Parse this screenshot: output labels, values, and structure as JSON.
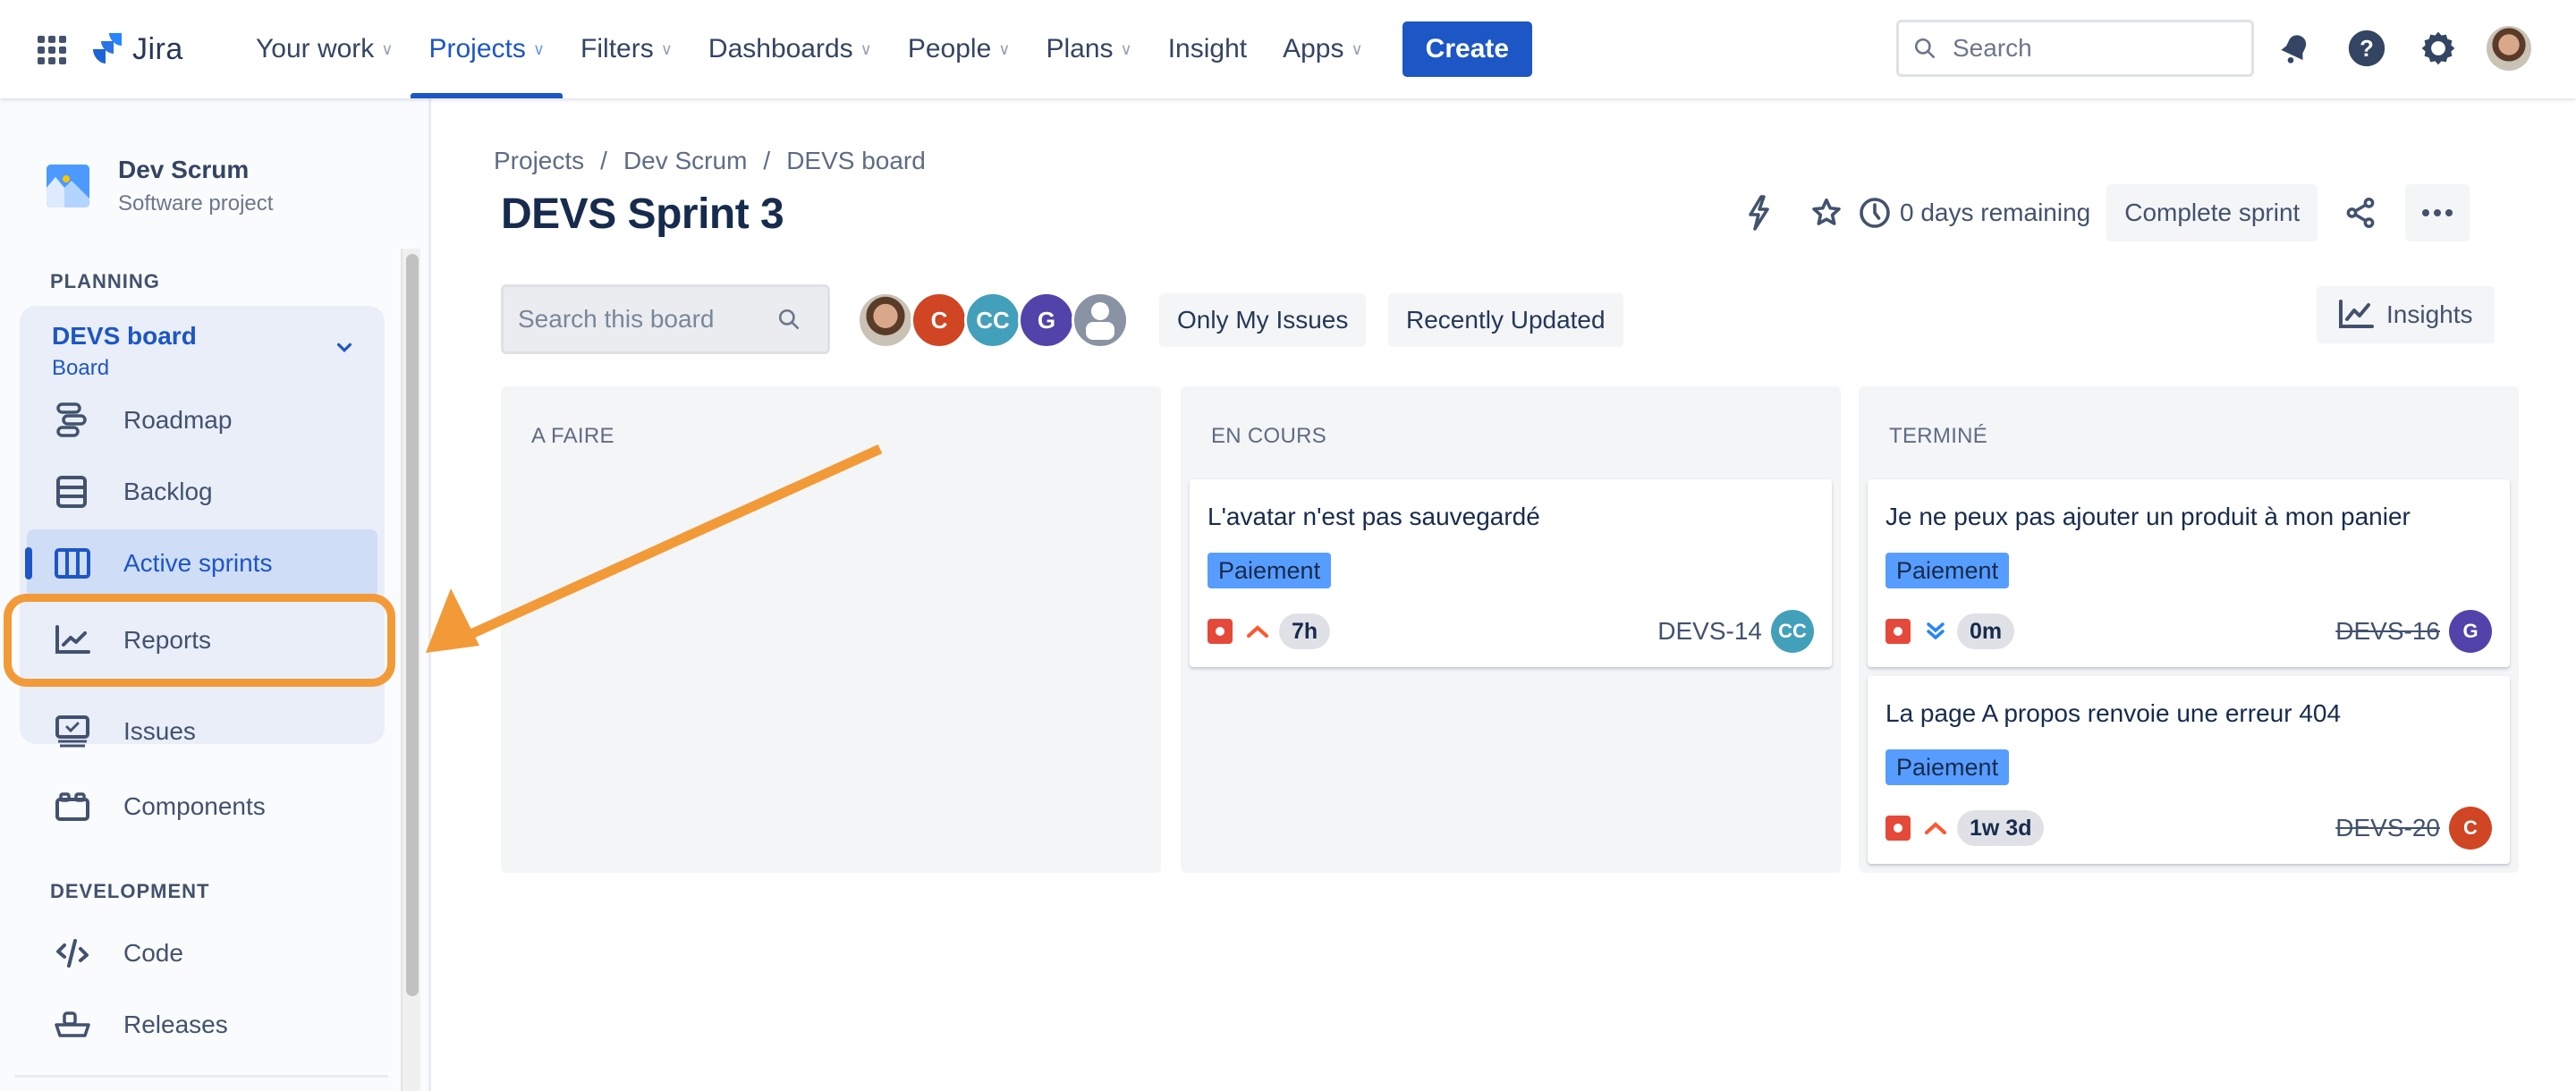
{
  "topnav": {
    "app_name": "Jira",
    "items": [
      {
        "label": "Your work",
        "has_dropdown": true
      },
      {
        "label": "Projects",
        "has_dropdown": true,
        "active": true
      },
      {
        "label": "Filters",
        "has_dropdown": true
      },
      {
        "label": "Dashboards",
        "has_dropdown": true
      },
      {
        "label": "People",
        "has_dropdown": true
      },
      {
        "label": "Plans",
        "has_dropdown": true
      },
      {
        "label": "Insight",
        "has_dropdown": false
      },
      {
        "label": "Apps",
        "has_dropdown": true
      }
    ],
    "create_label": "Create",
    "search_placeholder": "Search",
    "icons": [
      "app-switcher-icon",
      "notifications-icon",
      "help-icon",
      "settings-icon",
      "profile-avatar"
    ]
  },
  "sidebar": {
    "project_name": "Dev Scrum",
    "project_type": "Software project",
    "planning_label": "PLANNING",
    "board_name": "DEVS board",
    "board_type": "Board",
    "planning_items": [
      {
        "label": "Roadmap",
        "icon": "roadmap-icon"
      },
      {
        "label": "Backlog",
        "icon": "backlog-icon"
      },
      {
        "label": "Active sprints",
        "icon": "board-columns-icon",
        "active": true
      },
      {
        "label": "Reports",
        "icon": "reports-chart-icon",
        "highlighted": true
      }
    ],
    "other_items": [
      {
        "label": "Issues",
        "icon": "issues-icon"
      },
      {
        "label": "Components",
        "icon": "components-icon"
      }
    ],
    "development_label": "DEVELOPMENT",
    "development_items": [
      {
        "label": "Code",
        "icon": "code-icon"
      },
      {
        "label": "Releases",
        "icon": "releases-ship-icon"
      }
    ]
  },
  "breadcrumb": [
    "Projects",
    "Dev Scrum",
    "DEVS board"
  ],
  "page_title": "DEVS Sprint 3",
  "header_actions": {
    "days_remaining": "0 days remaining",
    "complete_sprint_label": "Complete sprint"
  },
  "toolbar": {
    "search_placeholder": "Search this board",
    "avatars": [
      {
        "initials": "",
        "type": "photo"
      },
      {
        "initials": "C",
        "color": "#d04523"
      },
      {
        "initials": "CC",
        "color": "#43a0bb"
      },
      {
        "initials": "G",
        "color": "#5243aa"
      },
      {
        "initials": "",
        "type": "unassigned",
        "color": "#8993a4"
      }
    ],
    "filters": [
      "Only My Issues",
      "Recently Updated"
    ],
    "insights_label": "Insights"
  },
  "columns": [
    {
      "title": "A FAIRE",
      "cards": []
    },
    {
      "title": "EN COURS",
      "cards": [
        {
          "title": "L'avatar n'est pas sauvegardé",
          "label": "Paiement",
          "type": "bug",
          "priority": "high",
          "estimate": "7h",
          "key": "DEVS-14",
          "done": false,
          "assignee": "CC",
          "assignee_color": "#43a0bb"
        }
      ]
    },
    {
      "title": "TERMINÉ",
      "cards": [
        {
          "title": "Je ne peux pas ajouter un produit à mon panier",
          "label": "Paiement",
          "type": "bug",
          "priority": "lowest",
          "estimate": "0m",
          "key": "DEVS-16",
          "done": true,
          "assignee": "G",
          "assignee_color": "#5243aa"
        },
        {
          "title": "La page A propos renvoie une erreur 404",
          "label": "Paiement",
          "type": "bug",
          "priority": "high",
          "estimate": "1w 3d",
          "key": "DEVS-20",
          "done": true,
          "assignee": "C",
          "assignee_color": "#d04523"
        }
      ]
    }
  ],
  "colors": {
    "brand_blue": "#1d56c5",
    "annotation_orange": "#f29a38",
    "label_blue": "#579dff",
    "bug_red": "#e5493a",
    "priority_high": "#ff5630",
    "priority_low": "#2684ff"
  }
}
